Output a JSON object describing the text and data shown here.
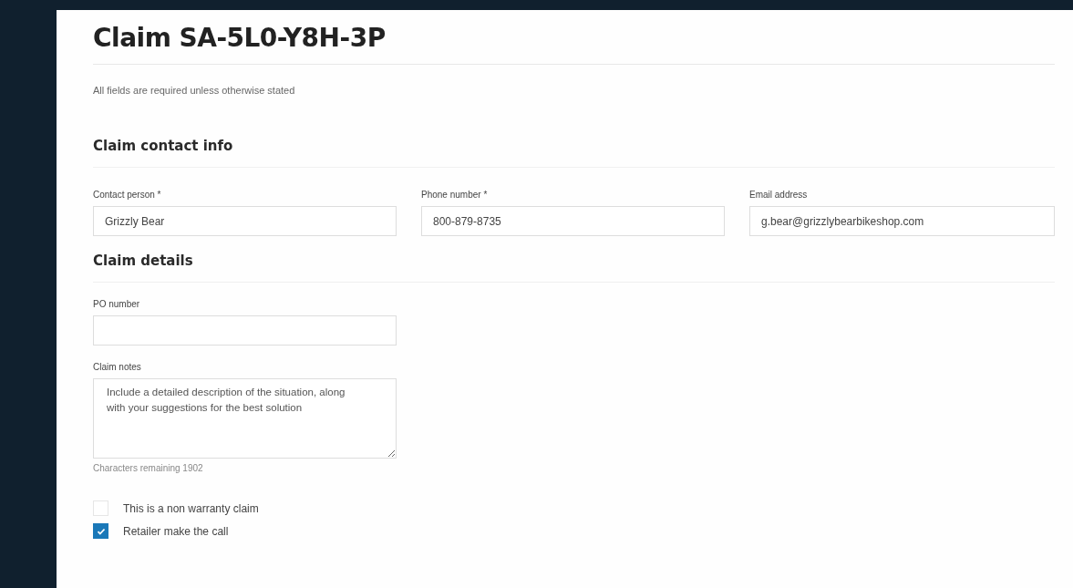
{
  "title": "Claim SA-5L0-Y8H-3P",
  "note": "All fields are required unless otherwise stated",
  "sections": [
    {
      "heading": "Claim contact info",
      "fields": [
        {
          "kind": "input",
          "label": "Contact person *",
          "value": "Grizzly Bear"
        },
        {
          "kind": "input",
          "label": "Phone number *",
          "value": "800-879-8735"
        },
        {
          "kind": "input",
          "label": "Email address",
          "value": "g.bear@grizzlybearbikeshop.com"
        }
      ]
    },
    {
      "heading": "Claim details",
      "fields": [
        {
          "kind": "input",
          "label": "PO number"
        },
        {
          "kind": "textarea",
          "label": "Claim notes",
          "placeholder": "Include a detailed description of the situation, along with your suggestions for the best solution",
          "hint": "Characters remaining 1902"
        }
      ]
    }
  ],
  "checkboxes": [
    {
      "label": "This is a non warranty claim",
      "checked": false
    },
    {
      "label": "Retailer make the call",
      "checked": true
    }
  ]
}
